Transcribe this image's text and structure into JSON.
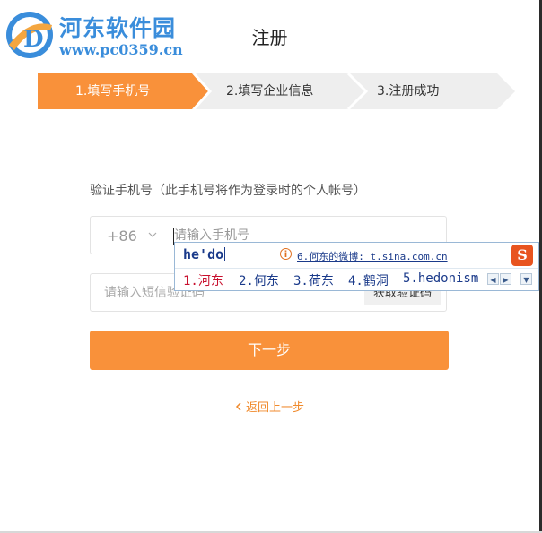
{
  "watermark": {
    "site_name": "河东软件园",
    "url": "www.pc0359.cn"
  },
  "page": {
    "title": "注册"
  },
  "steps": [
    {
      "label": "1.填写手机号",
      "active": true
    },
    {
      "label": "2.填写企业信息",
      "active": false
    },
    {
      "label": "3.注册成功",
      "active": false
    }
  ],
  "form": {
    "subtitle": "验证手机号（此手机号将作为登录时的个人帐号）",
    "country_code": "+86",
    "phone_placeholder": "请输入手机号",
    "sms_placeholder": "请输入短信验证码",
    "sms_button": "获取验证码",
    "next_button": "下一步",
    "back_link": "返回上一步"
  },
  "ime": {
    "typed": "he'do",
    "suggestion": "6.何东的微博: t.sina.com.cn",
    "candidates": [
      "1.河东",
      "2.何东",
      "3.荷东",
      "4.鹤洞",
      "5.hedonism"
    ]
  },
  "colors": {
    "accent": "#f9913a",
    "step_inactive": "#eeeeee",
    "link": "#f08a2c"
  }
}
